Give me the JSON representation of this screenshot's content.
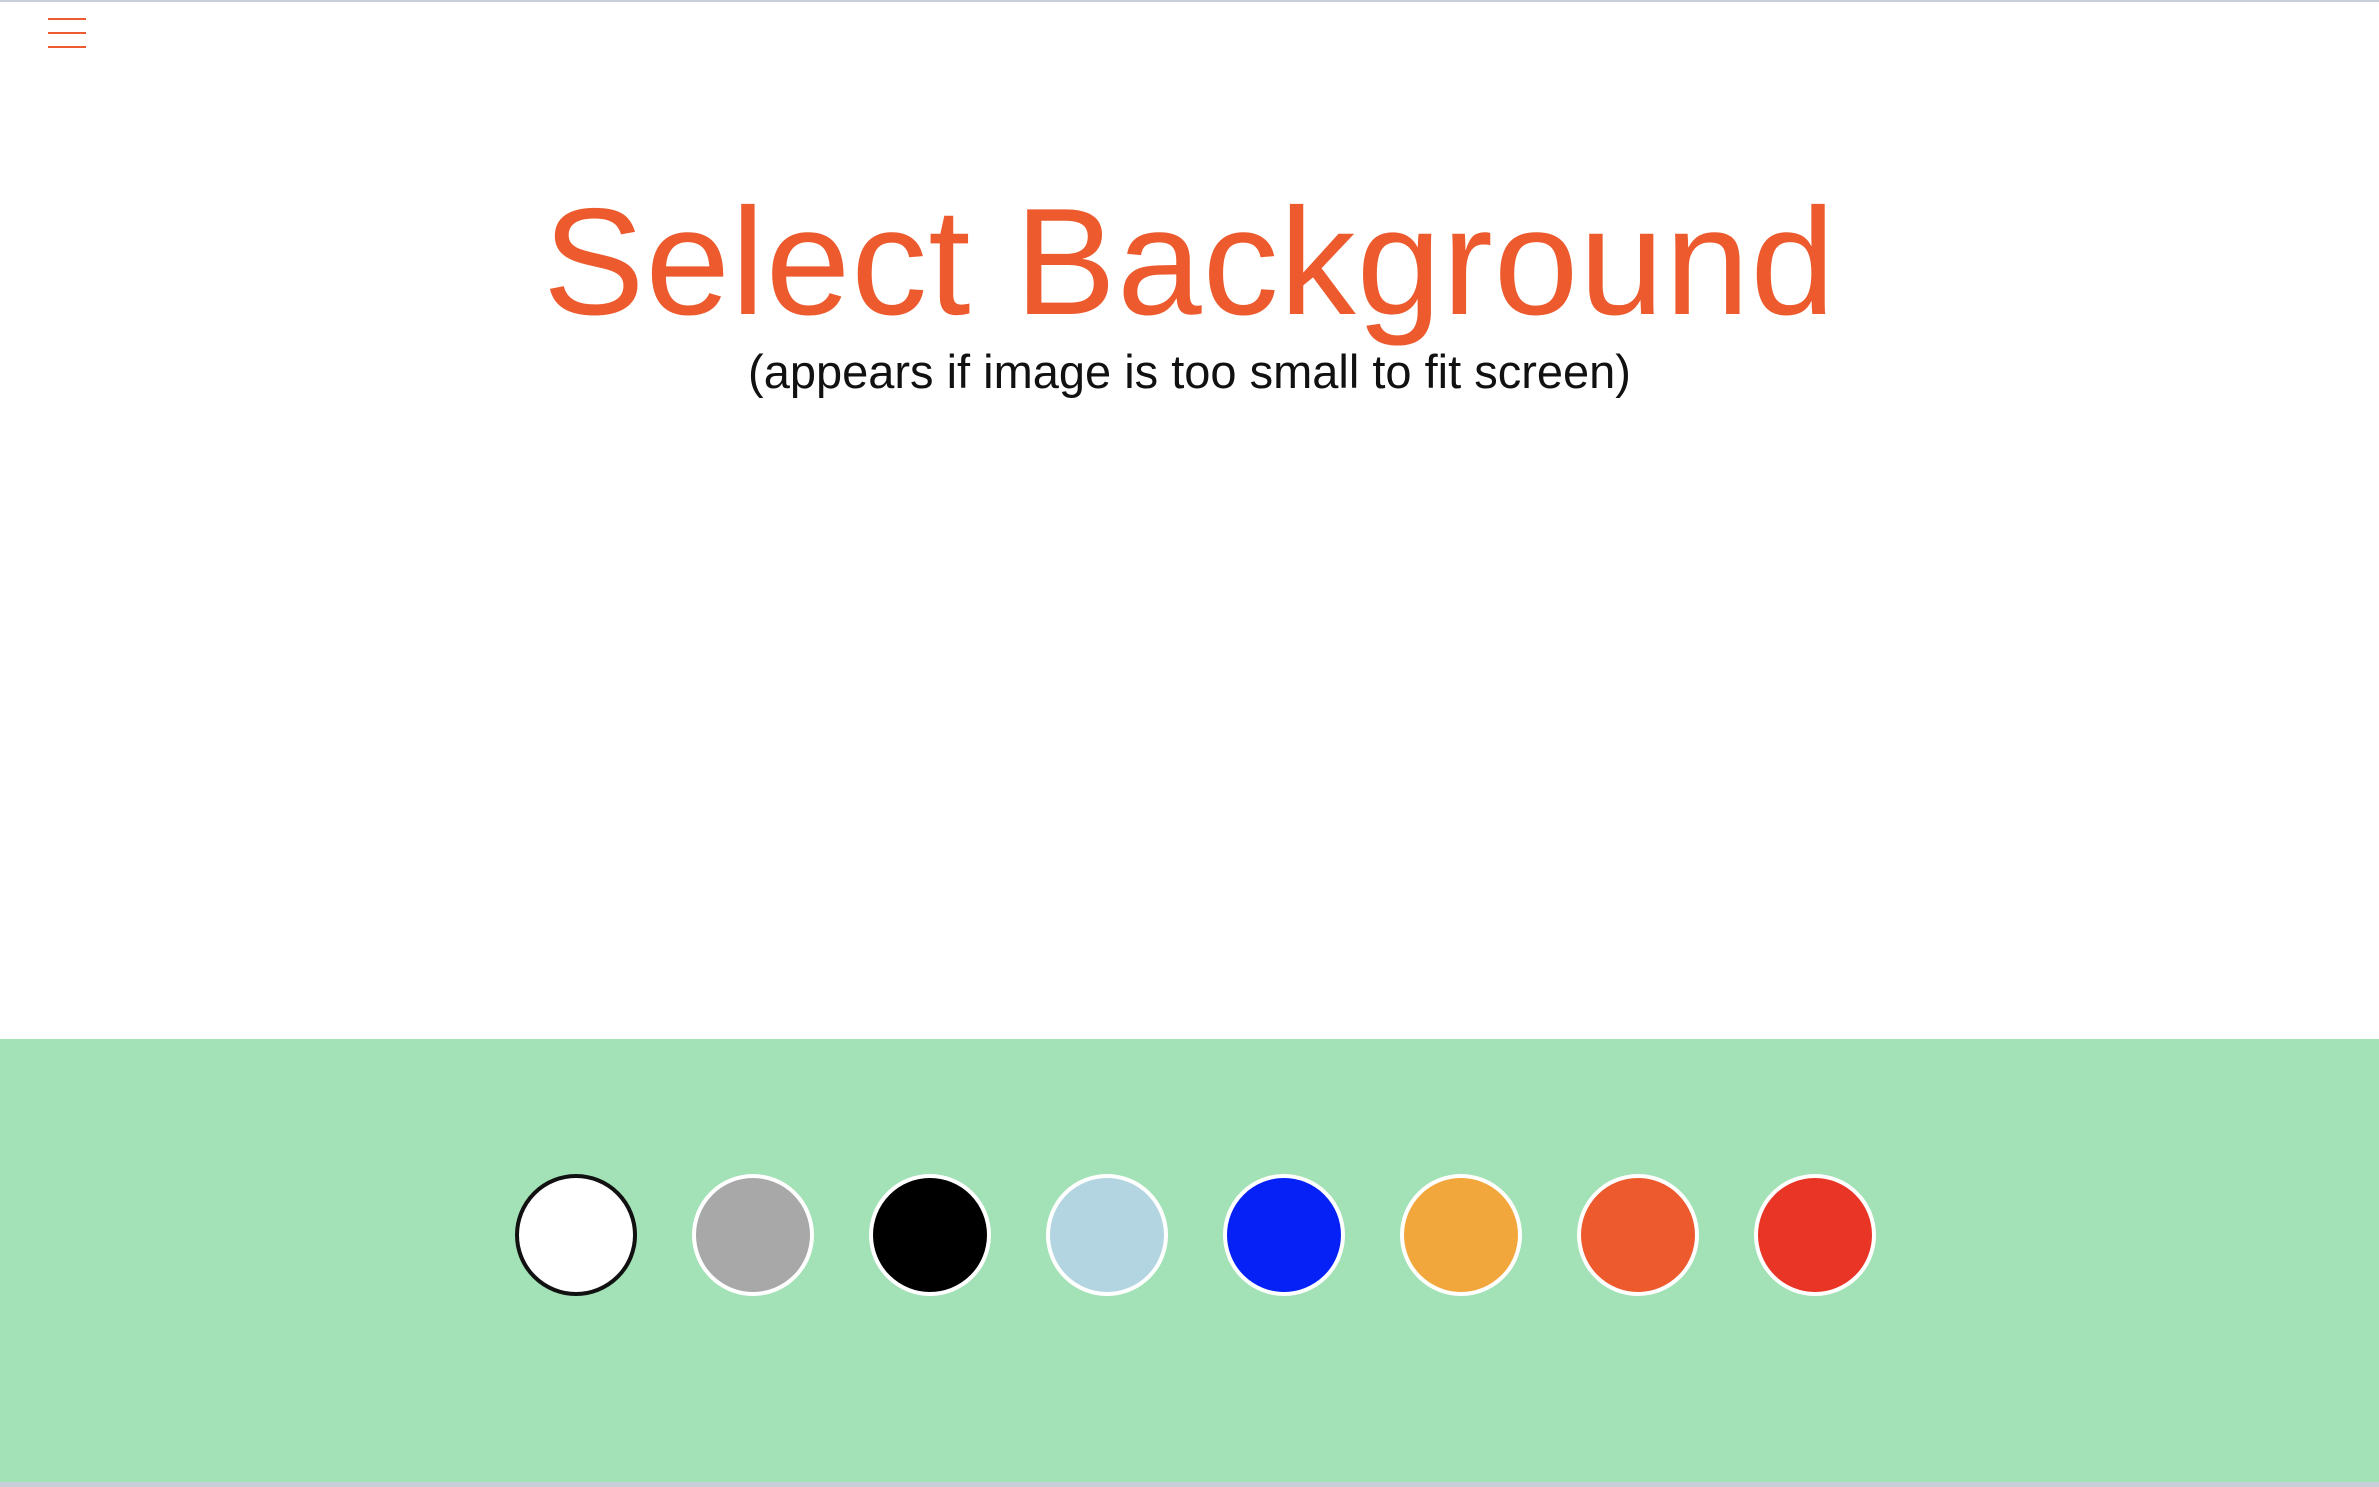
{
  "header": {
    "menu_icon": "hamburger-menu-icon",
    "title": "Select Background",
    "subtitle": "(appears if image is too small to fit screen)"
  },
  "colors": {
    "accent": "#ec5a2e",
    "panel_background": "#a3e1b6"
  },
  "palette": {
    "selected_index": 0,
    "swatches": [
      {
        "name": "white",
        "color": "#ffffff"
      },
      {
        "name": "gray",
        "color": "#a8a8a8"
      },
      {
        "name": "black",
        "color": "#000000"
      },
      {
        "name": "light-blue",
        "color": "#b3d5e1"
      },
      {
        "name": "blue",
        "color": "#0521f5"
      },
      {
        "name": "orange",
        "color": "#f2a73d"
      },
      {
        "name": "red-orange",
        "color": "#ec5a2e"
      },
      {
        "name": "red",
        "color": "#e93526"
      }
    ]
  }
}
